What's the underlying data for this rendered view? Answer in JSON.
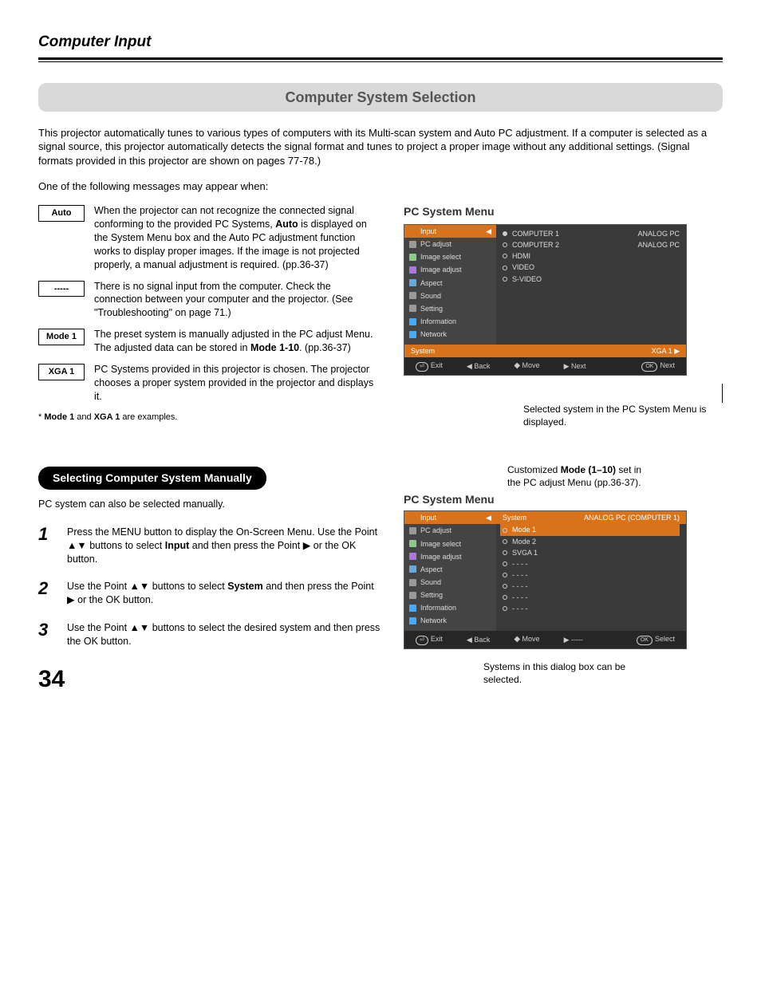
{
  "pageHead": "Computer Input",
  "sectionTitle": "Computer System Selection",
  "introPara": "This projector automatically tunes to various types of computers with its Multi-scan system and Auto PC adjustment. If a computer is selected as a signal source, this projector automatically detects the signal format and tunes to project a proper image without any additional settings. (Signal formats provided in this projector are shown on pages 77-78.)",
  "msgIntro": "One of the following messages may appear when:",
  "messages": {
    "auto": {
      "label": "Auto",
      "text": "When the projector can not recognize the connected signal conforming to the provided PC Systems, <b>Auto</b> is displayed on the System Menu box and the Auto PC adjustment function works to display proper images. If the image is not projected properly, a manual adjustment is required.   (pp.36-37)"
    },
    "dash": {
      "label": "-----",
      "text": "There is no signal input from the computer. Check the connection between your computer and the projector. (See \"Troubleshooting\" on page 71.)"
    },
    "mode1": {
      "label": "Mode 1",
      "text": "The preset system is manually adjusted in the PC adjust Menu. The adjusted data can be stored in <b>Mode 1-10</b>.  (pp.36-37)"
    },
    "xga1": {
      "label": "XGA 1",
      "text": "PC Systems provided in this projector is chosen. The projector chooses a proper system provided in the projector and displays it."
    }
  },
  "footnote": "* <b>Mode 1</b> and <b>XGA 1</b> are examples.",
  "rightHead1": "PC System Menu",
  "osd1": {
    "side": [
      "Input",
      "PC adjust",
      "Image select",
      "Image adjust",
      "Aspect",
      "Sound",
      "Setting",
      "Information",
      "Network"
    ],
    "content": [
      {
        "b": "f",
        "l": "COMPUTER 1",
        "r": "ANALOG PC"
      },
      {
        "b": "e",
        "l": "COMPUTER 2",
        "r": "ANALOG PC"
      },
      {
        "b": "e",
        "l": "HDMI",
        "r": ""
      },
      {
        "b": "e",
        "l": "VIDEO",
        "r": ""
      },
      {
        "b": "e",
        "l": "S-VIDEO",
        "r": ""
      }
    ],
    "sysBar": {
      "l": "System",
      "r": "XGA 1  ▶"
    },
    "footer": {
      "exit": "Exit",
      "back": "◀ Back",
      "move": "Move",
      "next": "▶ Next",
      "ok": "Next"
    }
  },
  "caption1": "Selected system in the PC System Menu is displayed.",
  "blackPill": "Selecting Computer System Manually",
  "stepLine": "PC system can also be selected manually.",
  "steps": {
    "s1": "Press the MENU button to display the On-Screen Menu. Use the Point ▲▼ buttons to select <b>Input</b> and then press the Point ▶ or the OK button.",
    "s2": "Use the Point ▲▼ buttons to select <b>System</b> and then press the Point ▶ or the OK button.",
    "s3": "Use the Point ▲▼ buttons to select the desired system and then press the OK button."
  },
  "caption2top": "Customized <b>Mode (1–10)</b> set in the PC adjust Menu (pp.36-37).",
  "rightHead2": "PC System Menu",
  "osd2": {
    "side": [
      "Input",
      "PC adjust",
      "Image select",
      "Image adjust",
      "Aspect",
      "Sound",
      "Setting",
      "Information",
      "Network"
    ],
    "headerBar": {
      "l": "System",
      "r": "ANALOG PC (COMPUTER 1)"
    },
    "content": [
      "Mode 1",
      "Mode 2",
      "SVGA 1",
      "- - - -",
      "- - - -",
      "- - - -",
      "- - - -",
      "- - - -"
    ],
    "footer": {
      "exit": "Exit",
      "back": "◀ Back",
      "move": "Move",
      "dash": "▶ -----",
      "ok": "Select"
    }
  },
  "caption2bottom": "Systems in this dialog box can be selected.",
  "pageNum": "34"
}
